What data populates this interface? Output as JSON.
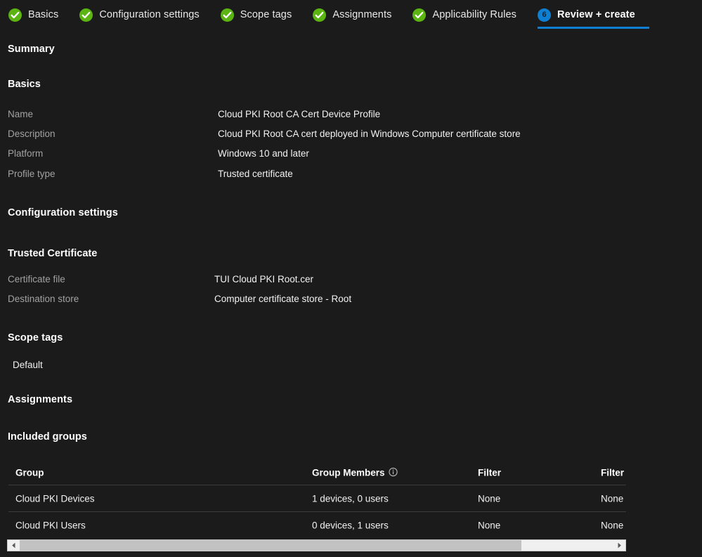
{
  "wizard": {
    "tabs": [
      {
        "label": "Basics",
        "state": "done",
        "step": "1"
      },
      {
        "label": "Configuration settings",
        "state": "done",
        "step": "2"
      },
      {
        "label": "Scope tags",
        "state": "done",
        "step": "3"
      },
      {
        "label": "Assignments",
        "state": "done",
        "step": "4"
      },
      {
        "label": "Applicability Rules",
        "state": "done",
        "step": "5"
      },
      {
        "label": "Review + create",
        "state": "current",
        "step": "6"
      }
    ],
    "accent_blue": "#0f7fd4",
    "check_green": "#5cb413"
  },
  "summary": {
    "heading": "Summary"
  },
  "basics": {
    "heading": "Basics",
    "rows": [
      {
        "label": "Name",
        "value": "Cloud PKI Root CA Cert Device Profile"
      },
      {
        "label": "Description",
        "value": "Cloud PKI Root CA cert deployed in Windows Computer certificate store"
      },
      {
        "label": "Platform",
        "value": "Windows 10 and later"
      },
      {
        "label": "Profile type",
        "value": "Trusted certificate"
      }
    ]
  },
  "configuration_settings": {
    "heading": "Configuration settings",
    "subheading": "Trusted Certificate",
    "rows": [
      {
        "label": "Certificate file",
        "value": "TUI Cloud PKI Root.cer"
      },
      {
        "label": "Destination store",
        "value": "Computer certificate store - Root"
      }
    ]
  },
  "scope_tags": {
    "heading": "Scope tags",
    "items": [
      "Default"
    ]
  },
  "assignments": {
    "heading": "Assignments",
    "included_groups_heading": "Included groups",
    "table": {
      "columns": [
        "Group",
        "Group Members",
        "Filter",
        "Filter"
      ],
      "info_tooltip_icon": "info-icon",
      "rows": [
        {
          "group": "Cloud PKI Devices",
          "members": "1 devices, 0 users",
          "filter_mode": "None",
          "filter_name": "None"
        },
        {
          "group": "Cloud PKI Users",
          "members": "0 devices, 1 users",
          "filter_mode": "None",
          "filter_name": "None"
        }
      ]
    }
  },
  "scrollbar": {
    "left_arrow_icon": "chevron-left-icon",
    "right_arrow_icon": "chevron-right-icon"
  }
}
